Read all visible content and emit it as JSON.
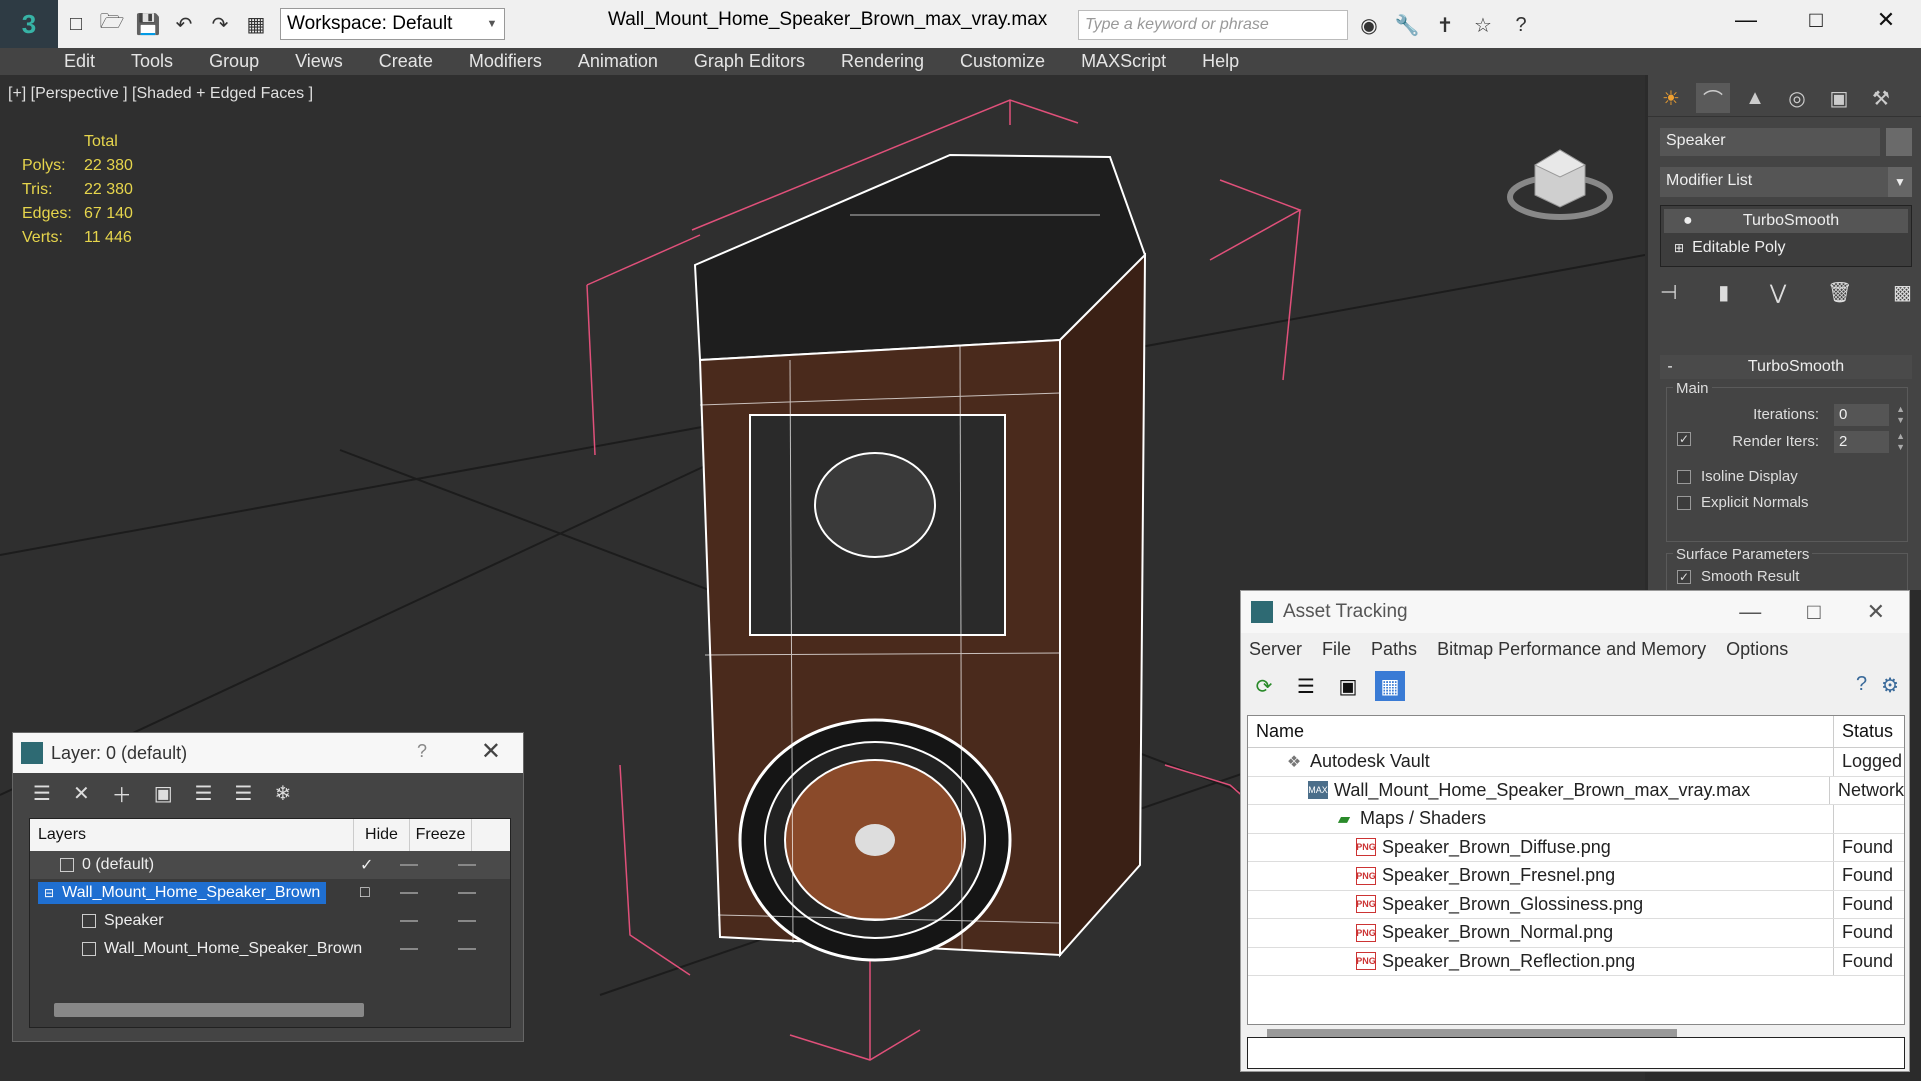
{
  "titlebar": {
    "workspace_label": "Workspace: Default",
    "file_title": "Wall_Mount_Home_Speaker_Brown_max_vray.max",
    "search_placeholder": "Type a keyword or phrase"
  },
  "menu": [
    "Edit",
    "Tools",
    "Group",
    "Views",
    "Create",
    "Modifiers",
    "Animation",
    "Graph Editors",
    "Rendering",
    "Customize",
    "MAXScript",
    "Help"
  ],
  "viewport": {
    "label": "[+] [Perspective ] [Shaded + Edged Faces ]",
    "stats": {
      "header": "Total",
      "rows": [
        {
          "label": "Polys:",
          "value": "22 380"
        },
        {
          "label": "Tris:",
          "value": "22 380"
        },
        {
          "label": "Edges:",
          "value": "67 140"
        },
        {
          "label": "Verts:",
          "value": "11 446"
        }
      ]
    }
  },
  "command_panel": {
    "object_name": "Speaker",
    "modifier_list": "Modifier List",
    "stack": [
      "TurboSmooth",
      "Editable Poly"
    ],
    "rollout_title": "TurboSmooth",
    "main_group": "Main",
    "iterations_label": "Iterations:",
    "iterations_value": "0",
    "render_iters_label": "Render Iters:",
    "render_iters_value": "2",
    "isoline_label": "Isoline Display",
    "explicit_normals_label": "Explicit Normals",
    "surface_group": "Surface Parameters",
    "smooth_result_label": "Smooth Result"
  },
  "layer_dialog": {
    "title": "Layer: 0 (default)",
    "help": "?",
    "columns": {
      "layers": "Layers",
      "hide": "Hide",
      "freeze": "Freeze"
    },
    "rows": [
      {
        "name": "0 (default)"
      },
      {
        "name": "Wall_Mount_Home_Speaker_Brown"
      },
      {
        "name": "Speaker"
      },
      {
        "name": "Wall_Mount_Home_Speaker_Brown"
      }
    ]
  },
  "asset_dialog": {
    "title": "Asset Tracking",
    "menu": [
      "Server",
      "File",
      "Paths",
      "Bitmap Performance and Memory",
      "Options"
    ],
    "columns": {
      "name": "Name",
      "status": "Status"
    },
    "rows": [
      {
        "name": "Autodesk Vault",
        "status": "Logged",
        "icon": "vault-icon"
      },
      {
        "name": "Wall_Mount_Home_Speaker_Brown_max_vray.max",
        "status": "Network",
        "icon": "max-file-icon"
      },
      {
        "name": "Maps / Shaders",
        "status": "",
        "icon": "maps-folder-icon"
      },
      {
        "name": "Speaker_Brown_Diffuse.png",
        "status": "Found",
        "icon": "png-icon"
      },
      {
        "name": "Speaker_Brown_Fresnel.png",
        "status": "Found",
        "icon": "png-icon"
      },
      {
        "name": "Speaker_Brown_Glossiness.png",
        "status": "Found",
        "icon": "png-icon"
      },
      {
        "name": "Speaker_Brown_Normal.png",
        "status": "Found",
        "icon": "png-icon"
      },
      {
        "name": "Speaker_Brown_Reflection.png",
        "status": "Found",
        "icon": "png-icon"
      }
    ]
  },
  "colors": {
    "accent": "#1f6fd1",
    "stats": "#e6d54c",
    "wood": "#4a2a1c",
    "gizmo": "#e0507a"
  }
}
